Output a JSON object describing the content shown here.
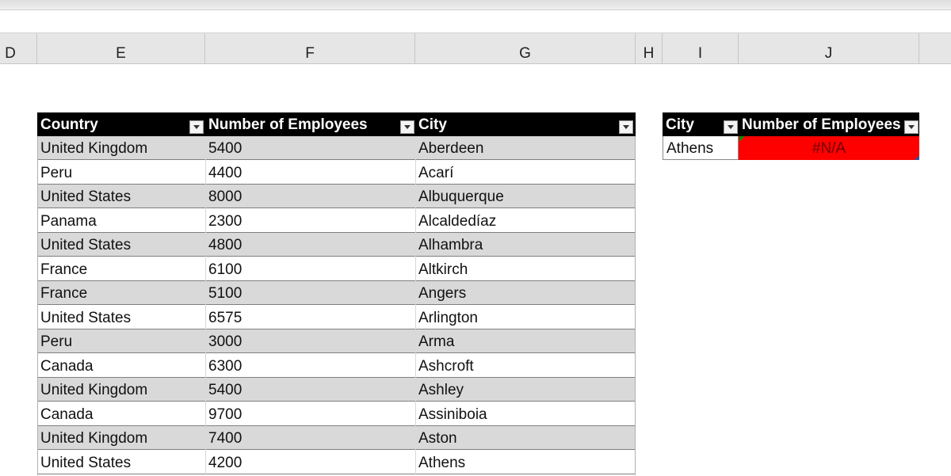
{
  "columns": [
    "D",
    "E",
    "F",
    "G",
    "H",
    "I",
    "J"
  ],
  "main_table": {
    "headers": [
      "Country",
      "Number of Employees",
      "City"
    ],
    "rows": [
      [
        "United Kingdom",
        "5400",
        "Aberdeen"
      ],
      [
        "Peru",
        "4400",
        "Acarí"
      ],
      [
        "United States",
        "8000",
        "Albuquerque"
      ],
      [
        "Panama",
        "2300",
        "Alcaldedíaz"
      ],
      [
        "United States",
        "4800",
        "Alhambra"
      ],
      [
        "France",
        "6100",
        "Altkirch"
      ],
      [
        "France",
        "5100",
        "Angers"
      ],
      [
        "United States",
        "6575",
        "Arlington"
      ],
      [
        "Peru",
        "3000",
        "Arma"
      ],
      [
        "Canada",
        "6300",
        "Ashcroft"
      ],
      [
        "United Kingdom",
        "5400",
        "Ashley"
      ],
      [
        "Canada",
        "9700",
        "Assiniboia"
      ],
      [
        "United Kingdom",
        "7400",
        "Aston"
      ],
      [
        "United States",
        "4200",
        "Athens"
      ]
    ]
  },
  "lookup_table": {
    "headers": [
      "City",
      "Number of Employees"
    ],
    "city_value": "Athens",
    "result_value": "#N/A",
    "result_fill_color": "#ff0000"
  },
  "colors": {
    "header_bg": "#000000",
    "header_text": "#ffffff",
    "band_row": "#d9d9d9",
    "error_fill": "#ff0000"
  },
  "icons": {
    "filter_button": "filter-dropdown-icon"
  }
}
